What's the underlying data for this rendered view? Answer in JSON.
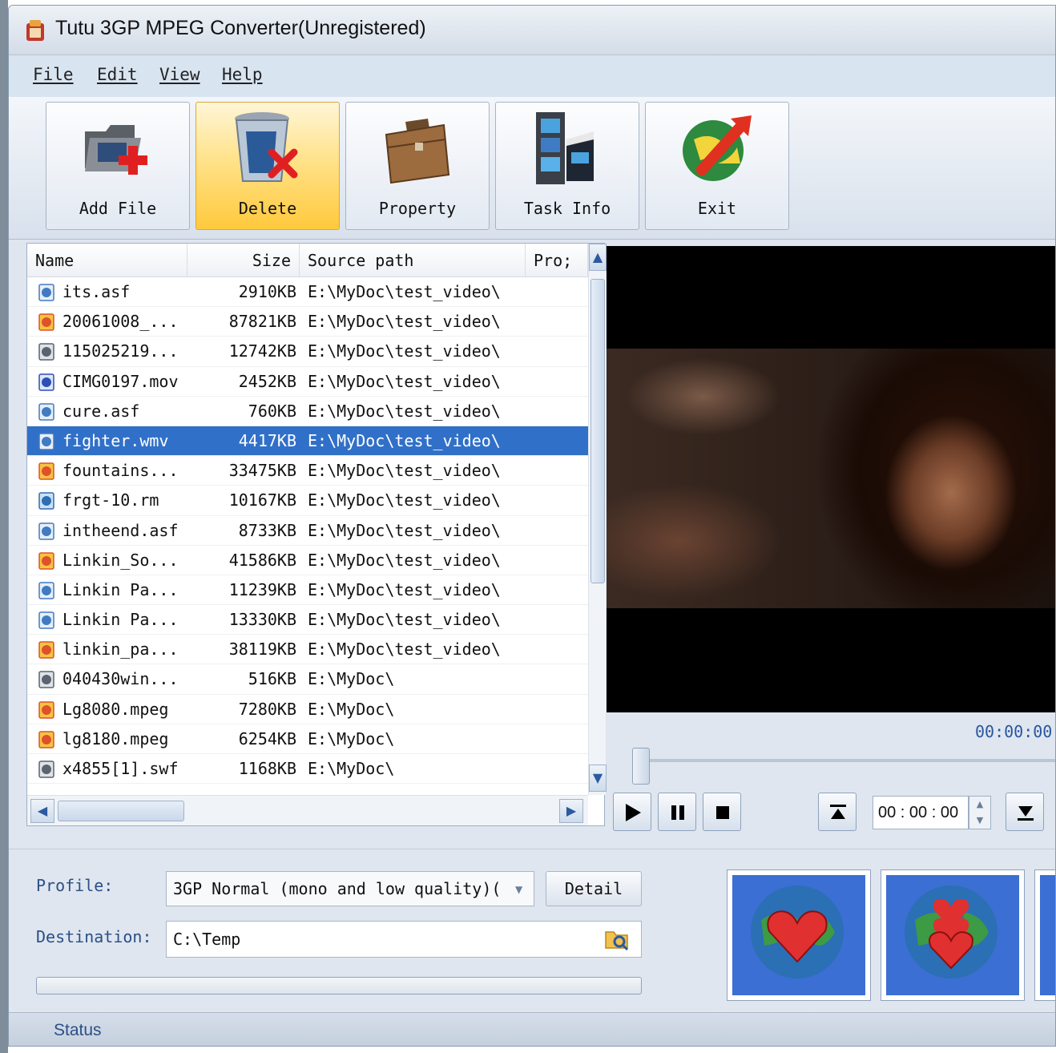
{
  "window": {
    "title": "Tutu 3GP MPEG Converter(Unregistered)"
  },
  "menu": [
    "File",
    "Edit",
    "View",
    "Help"
  ],
  "toolbar": {
    "add_file": "Add File",
    "delete": "Delete",
    "property": "Property",
    "task_info": "Task Info",
    "exit": "Exit"
  },
  "file_list": {
    "columns": [
      "Name",
      "Size",
      "Source path",
      "Pro;"
    ],
    "rows": [
      {
        "name": "its.asf",
        "size": "2910KB",
        "source": "E:\\MyDoc\\test_video\\",
        "icon": "wmv-file-icon"
      },
      {
        "name": "20061008_...",
        "size": "87821KB",
        "source": "E:\\MyDoc\\test_video\\",
        "icon": "mpeg-file-icon"
      },
      {
        "name": "115025219...",
        "size": "12742KB",
        "source": "E:\\MyDoc\\test_video\\",
        "icon": "flash-file-icon"
      },
      {
        "name": "CIMG0197.mov",
        "size": "2452KB",
        "source": "E:\\MyDoc\\test_video\\",
        "icon": "mov-file-icon"
      },
      {
        "name": "cure.asf",
        "size": "760KB",
        "source": "E:\\MyDoc\\test_video\\",
        "icon": "wmv-file-icon"
      },
      {
        "name": "fighter.wmv",
        "size": "4417KB",
        "source": "E:\\MyDoc\\test_video\\",
        "icon": "wmv-file-icon",
        "selected": true
      },
      {
        "name": "fountains...",
        "size": "33475KB",
        "source": "E:\\MyDoc\\test_video\\",
        "icon": "mpeg-file-icon"
      },
      {
        "name": "frgt-10.rm",
        "size": "10167KB",
        "source": "E:\\MyDoc\\test_video\\",
        "icon": "realmedia-file-icon"
      },
      {
        "name": "intheend.asf",
        "size": "8733KB",
        "source": "E:\\MyDoc\\test_video\\",
        "icon": "wmv-file-icon"
      },
      {
        "name": "Linkin_So...",
        "size": "41586KB",
        "source": "E:\\MyDoc\\test_video\\",
        "icon": "mpeg-file-icon"
      },
      {
        "name": "Linkin Pa...",
        "size": "11239KB",
        "source": "E:\\MyDoc\\test_video\\",
        "icon": "wmv-file-icon"
      },
      {
        "name": "Linkin Pa...",
        "size": "13330KB",
        "source": "E:\\MyDoc\\test_video\\",
        "icon": "wmv-file-icon"
      },
      {
        "name": "linkin_pa...",
        "size": "38119KB",
        "source": "E:\\MyDoc\\test_video\\",
        "icon": "mpeg-file-icon"
      },
      {
        "name": "040430win...",
        "size": "516KB",
        "source": "E:\\MyDoc\\",
        "icon": "flash-file-icon"
      },
      {
        "name": "Lg8080.mpeg",
        "size": "7280KB",
        "source": "E:\\MyDoc\\",
        "icon": "mpeg-file-icon"
      },
      {
        "name": "lg8180.mpeg",
        "size": "6254KB",
        "source": "E:\\MyDoc\\",
        "icon": "mpeg-file-icon"
      },
      {
        "name": "x4855[1].swf",
        "size": "1168KB",
        "source": "E:\\MyDoc\\",
        "icon": "flash-file-icon"
      }
    ]
  },
  "player": {
    "timecode": "00:00:00",
    "time_field": "00 : 00 : 00",
    "position": 0
  },
  "output": {
    "profile_label": "Profile:",
    "profile_value": "3GP Normal (mono and low quality)(",
    "detail_label": "Detail",
    "destination_label": "Destination:",
    "destination_value": "C:\\Temp",
    "progress": 0
  },
  "status": {
    "text": "Status"
  },
  "colors": {
    "accent": "#3170c8",
    "label": "#2b4f86",
    "convert_bg": "#3b6fd3"
  }
}
